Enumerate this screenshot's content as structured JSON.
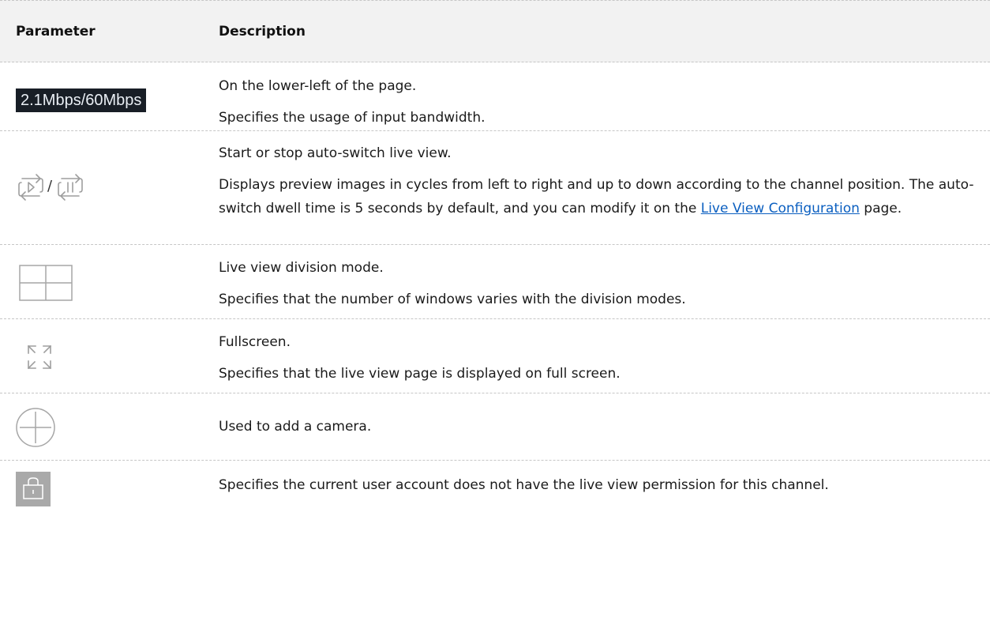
{
  "header": {
    "parameter": "Parameter",
    "description": "Description"
  },
  "rows": [
    {
      "icon": "bandwidth-badge",
      "badge_text": "2.1Mbps/60Mbps",
      "lines": [
        "On the lower-left of the page.",
        "Specifies the usage of input bandwidth."
      ]
    },
    {
      "icon": "auto-switch-play-pause-icons",
      "separator": "/",
      "line1": "Start or stop auto-switch live view.",
      "line2_before": "Displays preview images in cycles from left to right and up to down according to the channel position. The auto-switch dwell time is 5 seconds by default, and you can modify it on the ",
      "link": "Live View Configuration",
      "line2_after": " page."
    },
    {
      "icon": "division-mode-icon",
      "lines": [
        "Live view division mode.",
        "Specifies that the number of windows varies with the division modes."
      ]
    },
    {
      "icon": "fullscreen-icon",
      "lines": [
        "Fullscreen.",
        "Specifies that the live view page is displayed on full screen."
      ]
    },
    {
      "icon": "add-camera-icon",
      "lines": [
        "Used to add a camera."
      ]
    },
    {
      "icon": "lock-icon",
      "lines": [
        "Specifies the current user account does not have the live view permission for this channel."
      ]
    }
  ],
  "colors": {
    "header_bg": "#f2f2f2",
    "divider": "#c6c6c6",
    "link": "#0b5fc0",
    "badge_bg": "#181e26",
    "icon_gray": "#a9a9a9"
  }
}
